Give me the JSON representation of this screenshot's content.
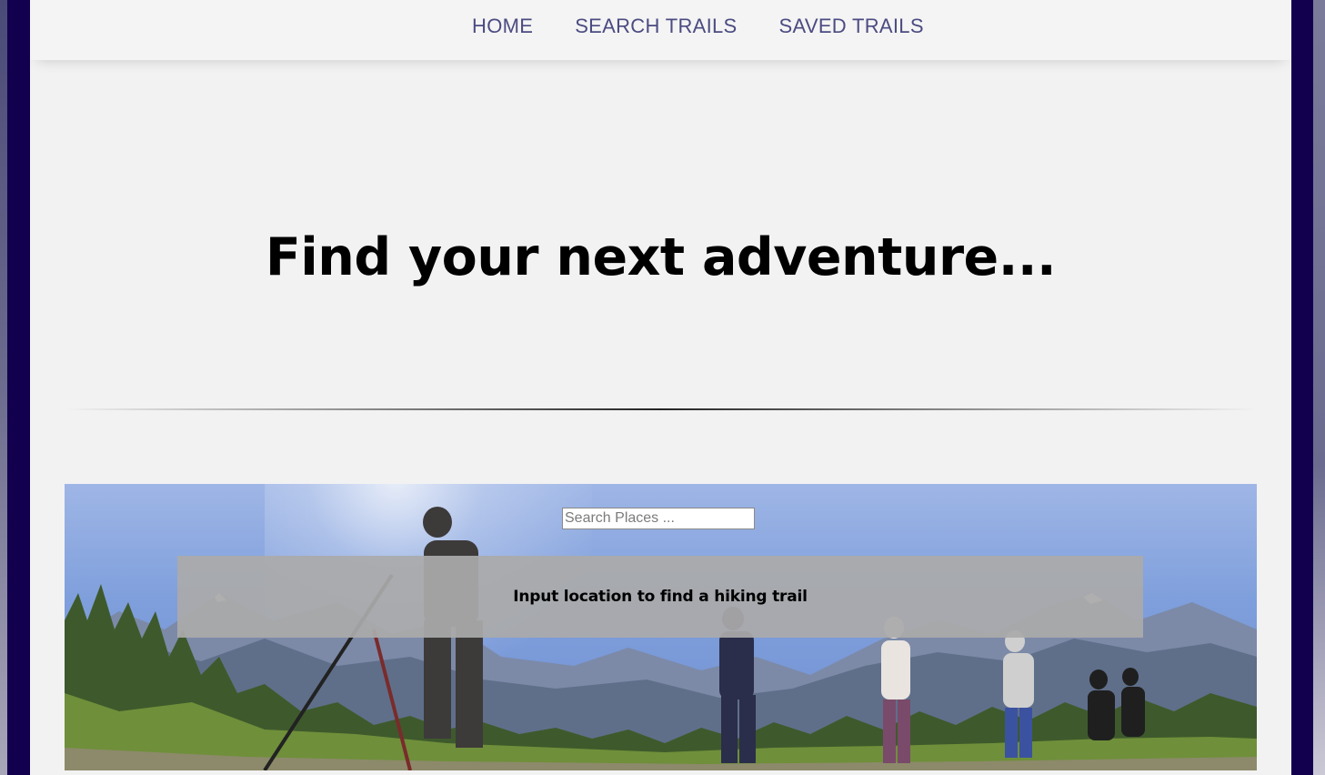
{
  "nav": {
    "items": [
      {
        "label": "HOME"
      },
      {
        "label": "SEARCH TRAILS"
      },
      {
        "label": "SAVED TRAILS"
      }
    ]
  },
  "hero": {
    "title": "Find your next adventure..."
  },
  "search": {
    "placeholder": "Search Places ...",
    "value": ""
  },
  "info": {
    "message": "Input location to find a hiking trail"
  },
  "colors": {
    "background_frame": "#12004f",
    "page_background": "#f2f2f2",
    "nav_link": "#4b4b82",
    "info_box": "#aaaaaa"
  }
}
